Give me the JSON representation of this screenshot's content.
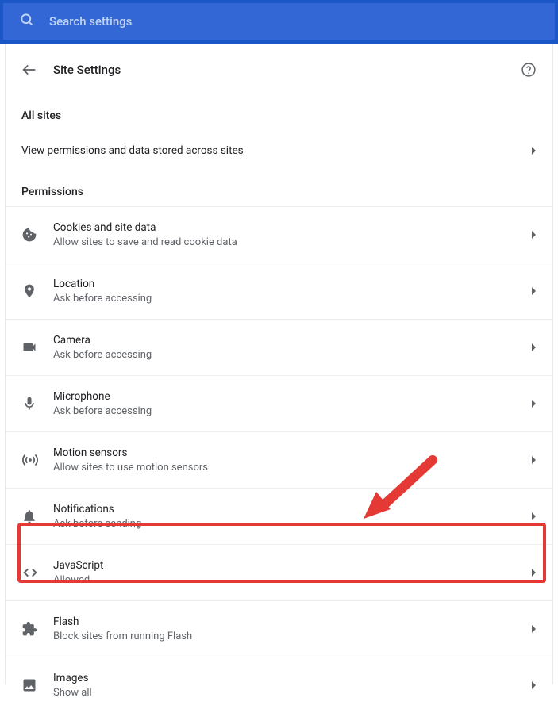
{
  "search": {
    "placeholder": "Search settings"
  },
  "header": {
    "title": "Site Settings"
  },
  "sections": {
    "all_sites_heading": "All sites",
    "view_permissions_label": "View permissions and data stored across sites",
    "permissions_heading": "Permissions"
  },
  "permissions": [
    {
      "icon": "cookie",
      "title": "Cookies and site data",
      "sub": "Allow sites to save and read cookie data"
    },
    {
      "icon": "location",
      "title": "Location",
      "sub": "Ask before accessing"
    },
    {
      "icon": "camera",
      "title": "Camera",
      "sub": "Ask before accessing"
    },
    {
      "icon": "microphone",
      "title": "Microphone",
      "sub": "Ask before accessing"
    },
    {
      "icon": "motion",
      "title": "Motion sensors",
      "sub": "Allow sites to use motion sensors"
    },
    {
      "icon": "bell",
      "title": "Notifications",
      "sub": "Ask before sending"
    },
    {
      "icon": "code",
      "title": "JavaScript",
      "sub": "Allowed"
    },
    {
      "icon": "puzzle",
      "title": "Flash",
      "sub": "Block sites from running Flash"
    },
    {
      "icon": "image",
      "title": "Images",
      "sub": "Show all"
    }
  ],
  "annotation": {
    "highlighted_item": "JavaScript"
  }
}
